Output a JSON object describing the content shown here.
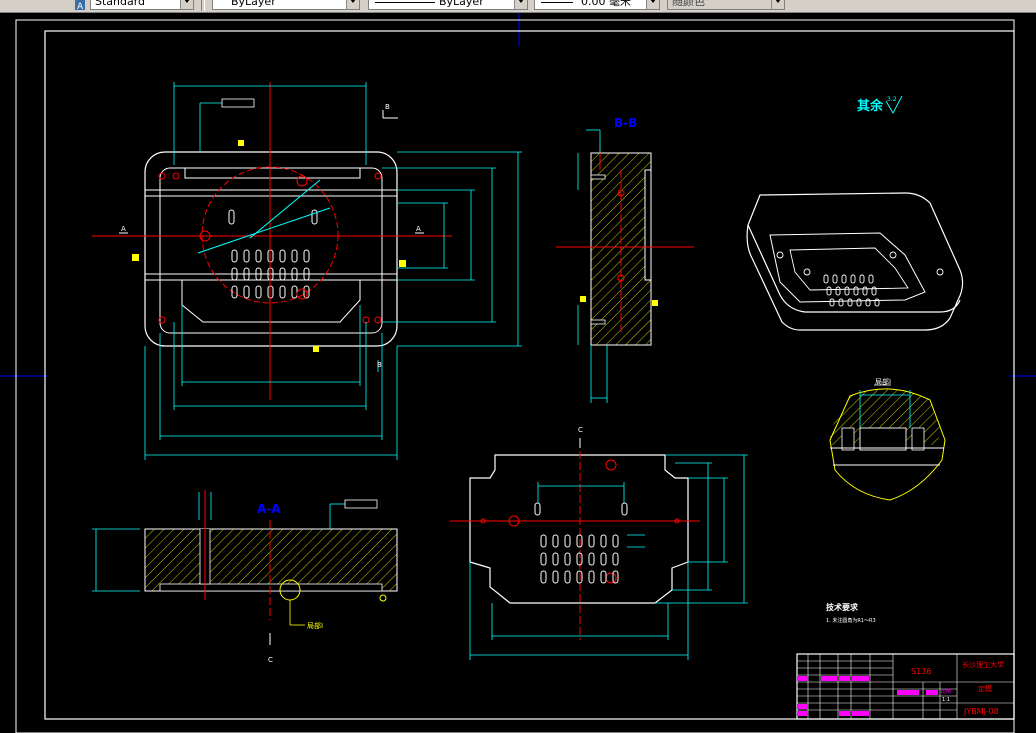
{
  "toolbar": {
    "text_style": "Standard",
    "layer": "ByLayer",
    "linetype": "ByLayer",
    "lineweight": "0.00 毫米",
    "plot_style": "随颜色"
  },
  "drawing": {
    "section_bb_label": "B-B",
    "section_aa_label": "A-A",
    "roughness_note": "其余",
    "roughness_value": "3.2",
    "cut_label_a": "A",
    "cut_label_b": "B",
    "cut_label_c": "C",
    "detail_label": "局部I",
    "detail_callout": "局部I",
    "tech_req_title": "技术要求",
    "tech_req_item": "1. 未注圆角为R1～R3",
    "title_block": {
      "part_code": "S136",
      "school": "长沙理工大学",
      "part_name": "定模",
      "drawing_no": "JYBMJ-08",
      "scale_label": "比例",
      "scale_value": "1:1"
    }
  }
}
